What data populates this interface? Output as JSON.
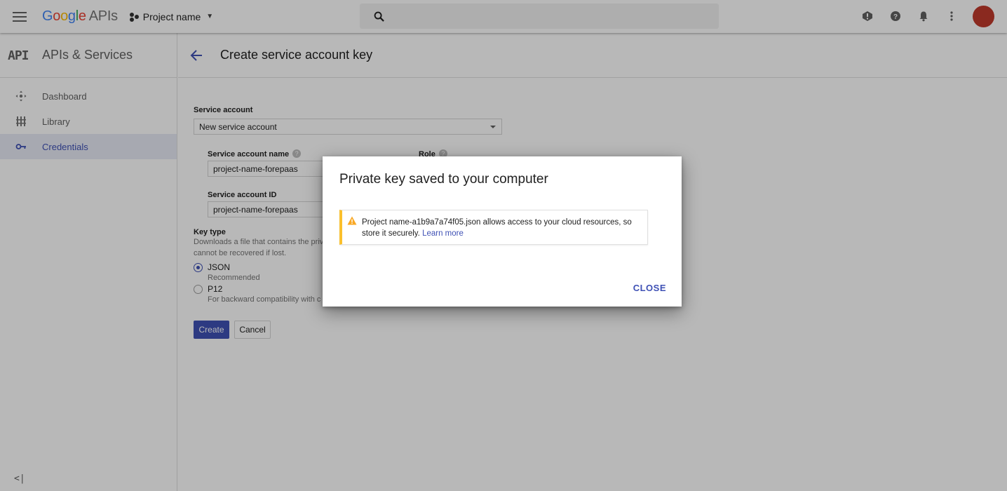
{
  "topbar": {
    "logo_google": "Google",
    "logo_apis": "APIs",
    "project_name": "Project name",
    "search_placeholder": "",
    "icons": [
      "menu-icon",
      "project-dots-icon",
      "search-icon",
      "feedback-icon",
      "help-icon",
      "notifications-icon",
      "more-vert-icon"
    ],
    "avatar_color": "#c0392b"
  },
  "sidebar": {
    "logo_text": "API",
    "title": "APIs & Services",
    "items": [
      {
        "label": "Dashboard",
        "icon": "dashboard-icon",
        "active": false
      },
      {
        "label": "Library",
        "icon": "library-icon",
        "active": false
      },
      {
        "label": "Credentials",
        "icon": "key-icon",
        "active": true
      }
    ],
    "collapse_label": "<|"
  },
  "page": {
    "title": "Create service account key"
  },
  "form": {
    "service_account_label": "Service account",
    "service_account_value": "New service account",
    "name_label": "Service account name",
    "name_value": "project-name-forepaas",
    "role_label": "Role",
    "id_label": "Service account ID",
    "id_value": "project-name-forepaas",
    "key_type_label": "Key type",
    "key_type_desc": "Downloads a file that contains the private key. Store the file securely because this key cannot be recovered if lost.",
    "key_type_desc_line1": "Downloads a file that contains the priv",
    "key_type_desc_line2": "cannot be recovered if lost.",
    "options": [
      {
        "label": "JSON",
        "sub": "Recommended",
        "selected": true
      },
      {
        "label": "P12",
        "sub": "For backward compatibility with c",
        "selected": false
      }
    ],
    "create_label": "Create",
    "cancel_label": "Cancel"
  },
  "dialog": {
    "title": "Private key saved to your computer",
    "warning_text": "Project name-a1b9a7a74f05.json allows access to your cloud resources, so store it securely.",
    "learn_more": "Learn more",
    "close_label": "CLOSE"
  },
  "colors": {
    "accent": "#3f51b5",
    "warning": "#fbc02d",
    "scrim": "rgba(0,0,0,0.28)"
  }
}
